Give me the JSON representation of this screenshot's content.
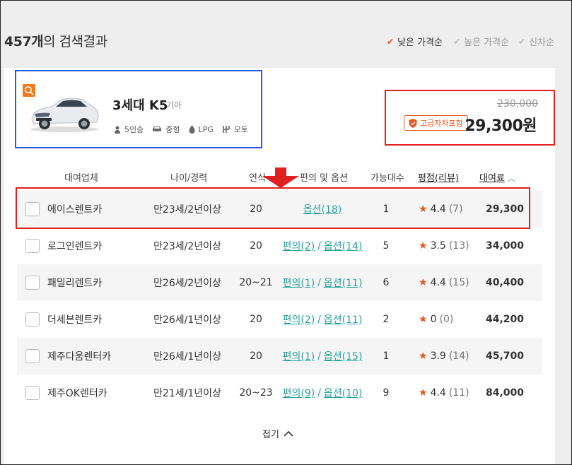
{
  "header": {
    "count": "457개",
    "title_suffix": "의 검색결과",
    "sort_options": [
      {
        "label": "낮은 가격순",
        "active": true
      },
      {
        "label": "높은 가격순",
        "active": false
      },
      {
        "label": "신차순",
        "active": false
      }
    ]
  },
  "car": {
    "name": "3세대 K5",
    "maker": "기아",
    "specs": {
      "seats": "5인승",
      "size": "중형",
      "fuel": "LPG",
      "transmission": "오토"
    }
  },
  "price_box": {
    "old_price": "230,000",
    "badge": "고급자차포함",
    "price": "29,300원"
  },
  "table": {
    "headers": {
      "company": "대여업체",
      "age": "나이/경력",
      "year": "연식",
      "options": "편의 및 옵션",
      "count": "가능대수",
      "rating": "평점(리뷰)",
      "fee": "대여료"
    },
    "rows": [
      {
        "company": "에이스렌트카",
        "age": "만23세/2년이상",
        "year": "20",
        "conv": "",
        "opt": "옵션(18)",
        "count": "1",
        "rating": "4.4",
        "reviews": "(7)",
        "fee": "29,300"
      },
      {
        "company": "로그인렌트카",
        "age": "만23세/2년이상",
        "year": "20",
        "conv": "편의(2)",
        "opt": "옵션(14)",
        "count": "5",
        "rating": "3.5",
        "reviews": "(13)",
        "fee": "34,000"
      },
      {
        "company": "패밀리렌트카",
        "age": "만26세/2년이상",
        "year": "20~21",
        "conv": "편의(1)",
        "opt": "옵션(11)",
        "count": "6",
        "rating": "4.4",
        "reviews": "(15)",
        "fee": "40,400"
      },
      {
        "company": "더세븐렌트카",
        "age": "만26세/1년이상",
        "year": "20",
        "conv": "편의(2)",
        "opt": "옵션(11)",
        "count": "2",
        "rating": "0",
        "reviews": "(0)",
        "fee": "44,200"
      },
      {
        "company": "제주다움렌터카",
        "age": "만26세/1년이상",
        "year": "20",
        "conv": "편의(1)",
        "opt": "옵션(15)",
        "count": "1",
        "rating": "3.9",
        "reviews": "(14)",
        "fee": "45,700"
      },
      {
        "company": "제주OK렌터카",
        "age": "만21세/1년이상",
        "year": "20~23",
        "conv": "편의(9)",
        "opt": "옵션(10)",
        "count": "9",
        "rating": "4.4",
        "reviews": "(11)",
        "fee": "84,000"
      }
    ]
  },
  "fold_label": "접기",
  "colors": {
    "accent": "#e8551e",
    "teal": "#2aa39a",
    "highlight_red": "#e02020",
    "card_blue": "#2a5bd7"
  }
}
